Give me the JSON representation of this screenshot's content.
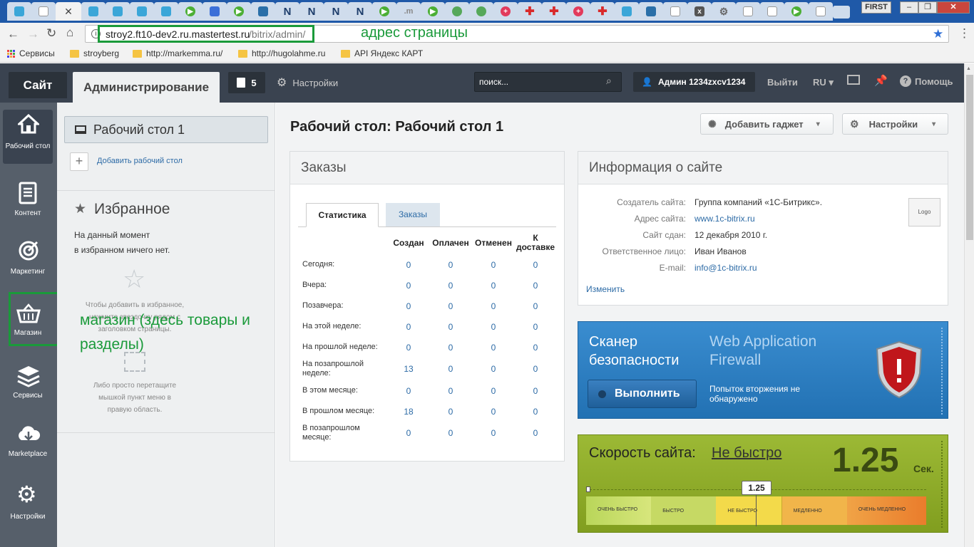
{
  "browser": {
    "first_label": "FIRST",
    "url_host": "stroy2.ft10-dev2.ru.mastertest.ru",
    "url_path": "/bitrix/admin/",
    "url_annotation": "адрес страницы",
    "bookmarks": [
      {
        "label": "Сервисы",
        "icon": "apps-grid-icon"
      },
      {
        "label": "stroyberg",
        "icon": "folder-icon"
      },
      {
        "label": "http://markemma.ru/",
        "icon": "folder-icon"
      },
      {
        "label": "http://hugolahme.ru",
        "icon": "folder-icon"
      },
      {
        "label": "API Яндекс КАРТ",
        "icon": "folder-icon"
      }
    ],
    "tab_letters": [
      "N",
      "N",
      "N",
      "N",
      ".m"
    ]
  },
  "topbar": {
    "site": "Сайт",
    "admin": "Администрирование",
    "notifications": "5",
    "settings": "Настройки",
    "search_placeholder": "поиск...",
    "user": "Админ 1234zxcv1234",
    "logout": "Выйти",
    "lang": "RU",
    "help": "Помощь"
  },
  "nav": [
    {
      "label": "Рабочий стол",
      "icon": "home-icon"
    },
    {
      "label": "Контент",
      "icon": "document-icon"
    },
    {
      "label": "Маркетинг",
      "icon": "target-icon"
    },
    {
      "label": "Магазин",
      "icon": "basket-icon"
    },
    {
      "label": "Сервисы",
      "icon": "layers-icon"
    },
    {
      "label": "Marketplace",
      "icon": "cloud-download-icon"
    },
    {
      "label": "Настройки",
      "icon": "gear-icon"
    }
  ],
  "panel": {
    "desktop": "Рабочий стол 1",
    "add_desktop": "Добавить рабочий стол",
    "fav_title": "Избранное",
    "fav_empty_1": "На данный момент",
    "fav_empty_2": "в избранном ничего нет.",
    "hint1_1": "Чтобы добавить в избранное,",
    "hint1_2": "нажмите звездочку рядом с",
    "hint1_3": "заголовком страницы.",
    "hint2_1": "Либо просто перетащите",
    "hint2_2": "мышкой пункт меню в",
    "hint2_3": "правую область.",
    "annotation_1": "магазин (здесь товары и",
    "annotation_2": "разделы)"
  },
  "main": {
    "title": "Рабочий стол: Рабочий стол 1",
    "add_gadget": "Добавить гаджет",
    "settings": "Настройки"
  },
  "orders": {
    "title": "Заказы",
    "tabs": [
      "Статистика",
      "Заказы"
    ],
    "columns": [
      "Создан",
      "Оплачен",
      "Отменен",
      "К доставке"
    ],
    "rows": [
      {
        "label": "Сегодня:",
        "values": [
          "0",
          "0",
          "0",
          "0"
        ]
      },
      {
        "label": "Вчера:",
        "values": [
          "0",
          "0",
          "0",
          "0"
        ]
      },
      {
        "label": "Позавчера:",
        "values": [
          "0",
          "0",
          "0",
          "0"
        ]
      },
      {
        "label": "На этой неделе:",
        "values": [
          "0",
          "0",
          "0",
          "0"
        ]
      },
      {
        "label": "На прошлой неделе:",
        "values": [
          "0",
          "0",
          "0",
          "0"
        ]
      },
      {
        "label": "На позапрошлой неделе:",
        "values": [
          "13",
          "0",
          "0",
          "0"
        ]
      },
      {
        "label": "В этом месяце:",
        "values": [
          "0",
          "0",
          "0",
          "0"
        ]
      },
      {
        "label": "В прошлом месяце:",
        "values": [
          "18",
          "0",
          "0",
          "0"
        ]
      },
      {
        "label": "В позапрошлом месяце:",
        "values": [
          "0",
          "0",
          "0",
          "0"
        ]
      }
    ]
  },
  "siteinfo": {
    "title": "Информация о сайте",
    "rows": [
      {
        "label": "Создатель сайта:",
        "value": "Группа компаний «1С-Битрикс»."
      },
      {
        "label": "Адрес сайта:",
        "value": "www.1c-bitrix.ru"
      },
      {
        "label": "Сайт сдан:",
        "value": "12 декабря 2010 г."
      },
      {
        "label": "Ответственное лицо:",
        "value": "Иван Иванов"
      },
      {
        "label": "E-mail:",
        "value": "info@1c-bitrix.ru"
      }
    ],
    "logo": "Logo",
    "edit": "Изменить"
  },
  "scanner": {
    "title_1": "Сканер",
    "title_2": "безопасности",
    "waf_1": "Web Application",
    "waf_2": "Firewall",
    "run": "Выполнить",
    "status_1": "Попыток вторжения не",
    "status_2": "обнаружено"
  },
  "speed": {
    "label": "Скорость сайта:",
    "status": "Не быстро",
    "value": "1.25",
    "unit": "Сек.",
    "marker": "1.25",
    "scale": [
      "ОЧЕНЬ БЫСТРО",
      "БЫСТРО",
      "НЕ БЫСТРО",
      "МЕДЛЕННО",
      "ОЧЕНЬ МЕДЛЕННО"
    ]
  },
  "colors": {
    "annotation": "#1a9a3a",
    "link": "#2d6ba6",
    "scanner_bg": "#2d7fc1",
    "speed_bg": "#8fae2a"
  }
}
